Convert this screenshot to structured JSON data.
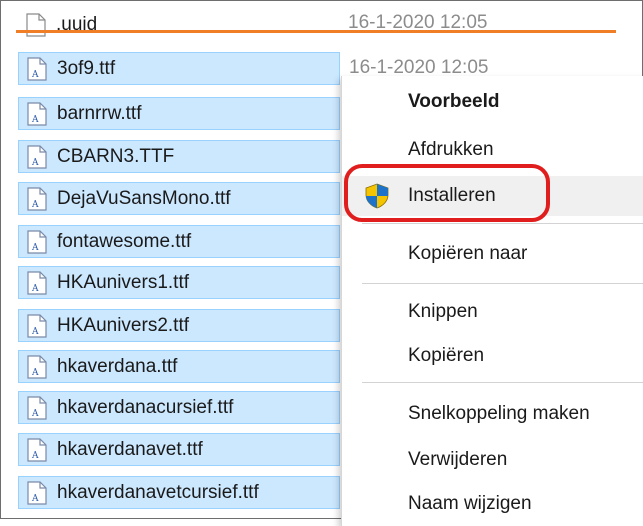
{
  "files": [
    {
      "name": ".uuid",
      "date": "16-1-2020 12:05",
      "selected": false,
      "icon": "blank-file-icon"
    },
    {
      "name": "3of9.ttf",
      "date": "16-1-2020 12:05",
      "selected": true,
      "icon": "font-file-icon"
    },
    {
      "name": "barnrrw.ttf",
      "selected": true,
      "icon": "font-file-icon"
    },
    {
      "name": "CBARN3.TTF",
      "selected": true,
      "icon": "font-file-icon"
    },
    {
      "name": "DejaVuSansMono.ttf",
      "selected": true,
      "icon": "font-file-icon"
    },
    {
      "name": "fontawesome.ttf",
      "selected": true,
      "icon": "font-file-icon"
    },
    {
      "name": "HKAunivers1.ttf",
      "selected": true,
      "icon": "font-file-icon"
    },
    {
      "name": "HKAunivers2.ttf",
      "selected": true,
      "icon": "font-file-icon"
    },
    {
      "name": "hkaverdana.ttf",
      "selected": true,
      "icon": "font-file-icon"
    },
    {
      "name": "hkaverdanacursief.ttf",
      "selected": true,
      "icon": "font-file-icon"
    },
    {
      "name": "hkaverdanavet.ttf",
      "selected": true,
      "icon": "font-file-icon"
    },
    {
      "name": "hkaverdanavetcursief.ttf",
      "selected": true,
      "icon": "font-file-icon"
    }
  ],
  "context_menu": {
    "items": [
      {
        "label": "Voorbeeld",
        "bold": true
      },
      {
        "label": "Afdrukken"
      },
      {
        "label": "Installeren",
        "icon": "uac-shield-icon",
        "highlighted": true
      },
      {
        "label": "Kopiëren naar"
      },
      {
        "label": "Knippen"
      },
      {
        "label": "Kopiëren"
      },
      {
        "label": "Snelkoppeling maken"
      },
      {
        "label": "Verwijderen"
      },
      {
        "label": "Naam wijzigen"
      }
    ]
  },
  "colors": {
    "selection_bg": "#cce8ff",
    "selection_border": "#99d1ff",
    "annotation_red": "#e01e1e",
    "strike_orange": "#f07e27",
    "shield_blue": "#1e73c8",
    "shield_yellow": "#f5c400"
  }
}
